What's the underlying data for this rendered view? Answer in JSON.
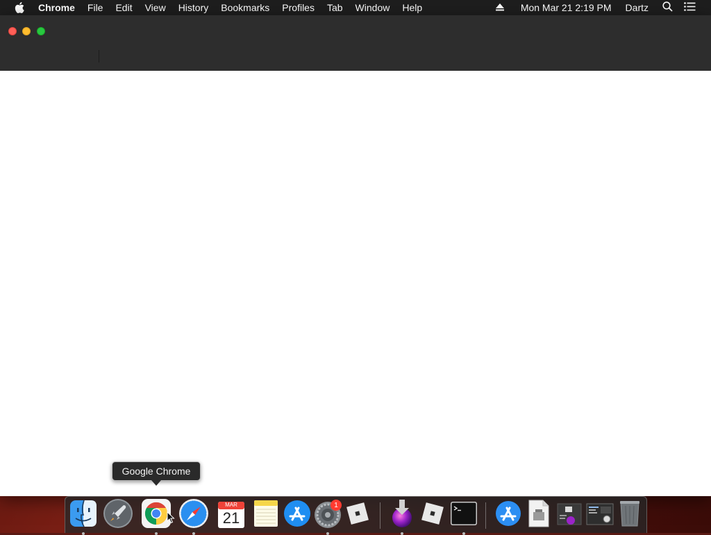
{
  "menubar": {
    "app_name": "Chrome",
    "items": [
      "File",
      "Edit",
      "View",
      "History",
      "Bookmarks",
      "Profiles",
      "Tab",
      "Window",
      "Help"
    ],
    "clock": "Mon Mar 21  2:19 PM",
    "user": "Dartz"
  },
  "window": {
    "title": "",
    "traffic_lights": {
      "close": "#ff5f57",
      "minimize": "#febc2e",
      "zoom": "#28c840"
    }
  },
  "tooltip": {
    "text": "Google Chrome"
  },
  "dock": {
    "items": [
      {
        "name": "Finder",
        "icon": "finder-icon",
        "running": true
      },
      {
        "name": "Launchpad",
        "icon": "launchpad-icon",
        "running": false
      },
      {
        "name": "Google Chrome",
        "icon": "chrome-icon",
        "running": true
      },
      {
        "name": "Safari",
        "icon": "safari-icon",
        "running": true
      },
      {
        "name": "Calendar",
        "icon": "calendar-icon",
        "running": false,
        "month": "MAR",
        "day": "21"
      },
      {
        "name": "Notes",
        "icon": "notes-icon",
        "running": false
      },
      {
        "name": "App Store",
        "icon": "app-store-icon",
        "running": false
      },
      {
        "name": "System Preferences",
        "icon": "system-preferences-icon",
        "running": true,
        "badge": "1"
      },
      {
        "name": "Roblox",
        "icon": "roblox-icon",
        "running": false
      },
      {
        "name": "Installer",
        "icon": "installer-icon",
        "running": true
      },
      {
        "name": "Roblox Studio",
        "icon": "roblox-studio-icon",
        "running": false
      },
      {
        "name": "Terminal",
        "icon": "terminal-icon",
        "running": true
      },
      {
        "name": "Applications",
        "icon": "applications-folder-icon",
        "running": false
      },
      {
        "name": "Document",
        "icon": "document-icon",
        "running": false
      },
      {
        "name": "Downloads",
        "icon": "downloads-stack-icon",
        "running": false
      },
      {
        "name": "Screenshots",
        "icon": "screenshots-stack-icon",
        "running": false
      },
      {
        "name": "Trash",
        "icon": "trash-icon",
        "running": false
      }
    ]
  }
}
